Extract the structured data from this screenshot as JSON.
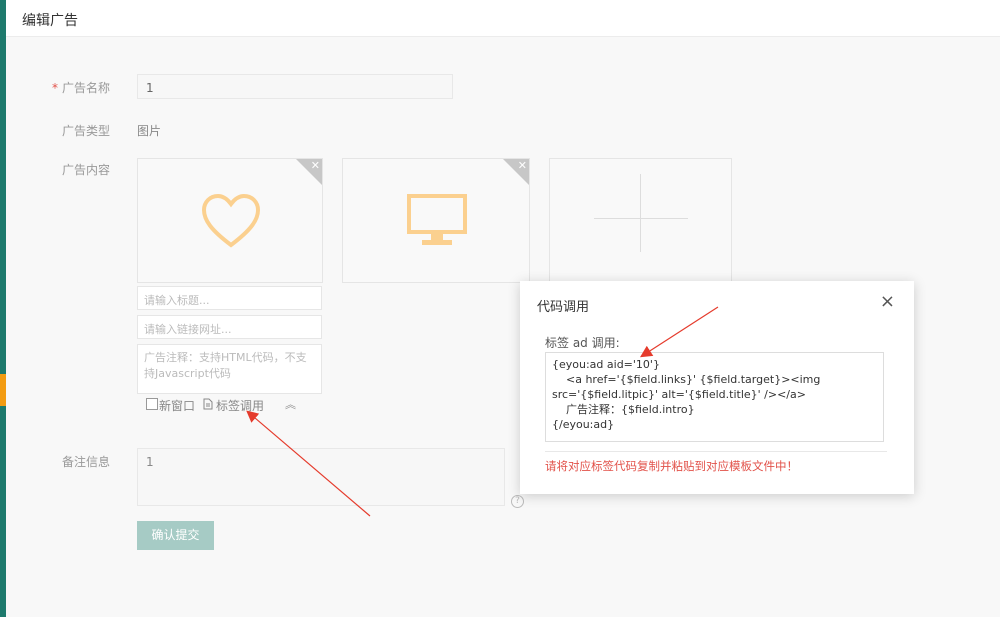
{
  "header": {
    "title": "编辑广告"
  },
  "form": {
    "name_label": "广告名称",
    "name_value": "1",
    "type_label": "广告类型",
    "type_value": "图片",
    "content_label": "广告内容",
    "title_placeholder": "请输入标题...",
    "link_placeholder": "请输入链接网址...",
    "note_placeholder": "广告注释：支持HTML代码，不支持Javascript代码",
    "new_window_label": "新窗口",
    "tag_call_label": "标签调用",
    "remark_label": "备注信息",
    "remark_value": "1",
    "submit_label": "确认提交"
  },
  "modal": {
    "title": "代码调用",
    "close": "×",
    "label": "标签 ad 调用:",
    "code": "{eyou:ad aid='10'}\n    <a href='{$field.links}' {$field.target}><img src='{$field.litpic}' alt='{$field.title}' /></a>\n    广告注释：{$field.intro}\n{/eyou:ad}",
    "tip": "请将对应标签代码复制并粘贴到对应模板文件中！"
  },
  "colors": {
    "accent": "#1e7a6d",
    "warning": "#f39c12",
    "danger": "#e2524a",
    "icon": "#fbd08f"
  },
  "icons": [
    "heart-icon",
    "monitor-icon",
    "plus-icon",
    "close-icon",
    "document-icon",
    "chevron-up-icon",
    "help-icon"
  ]
}
